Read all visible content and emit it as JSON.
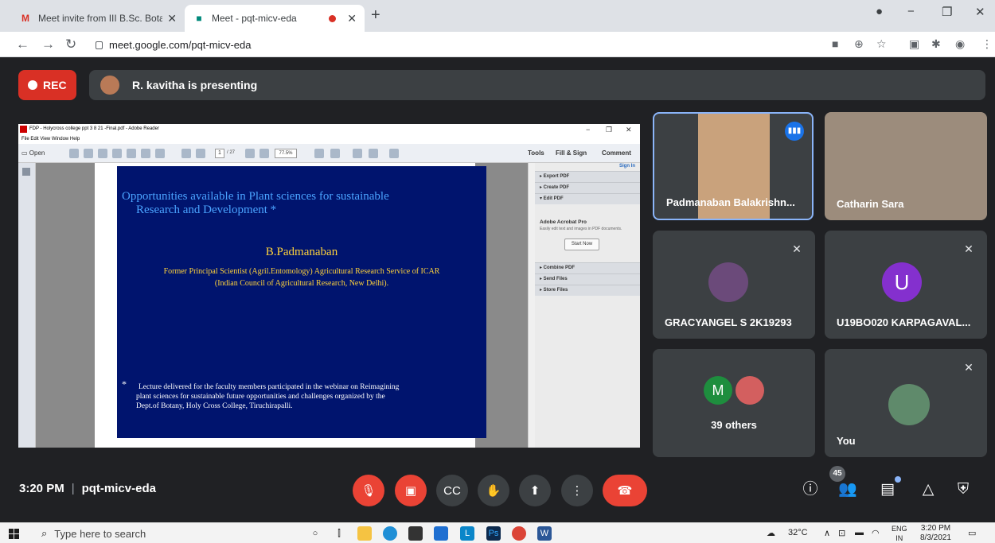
{
  "browser": {
    "tabs": [
      {
        "title": "Meet invite from III B.Sc. Botany"
      },
      {
        "title": "Meet - pqt-micv-eda"
      }
    ],
    "url": "meet.google.com/pqt-micv-eda"
  },
  "meet": {
    "rec_label": "REC",
    "presenting_text": "R. kavitha is presenting",
    "meeting_time": "3:20 PM",
    "meeting_code": "pqt-micv-eda",
    "people_count": "45"
  },
  "reader": {
    "window_title": "FDP - Holycross college ppt 3 8 21 -Final.pdf - Adobe Reader",
    "menu": "File   Edit   View   Window   Help",
    "open_label": "Open",
    "page_current": "1",
    "page_total": "/ 27",
    "zoom": "77.5%",
    "tools_label": "Tools",
    "fill_sign_label": "Fill & Sign",
    "comment_label": "Comment",
    "sign_in": "Sign In",
    "pane": {
      "export_pdf": "▸ Export PDF",
      "create_pdf": "▸ Create PDF",
      "edit_pdf": "▾ Edit PDF",
      "acrobat_pro": "Adobe Acrobat Pro",
      "acrobat_desc": "Easily edit text and images in PDF documents.",
      "start_now": "Start Now",
      "combine_pdf": "▸ Combine PDF",
      "send_files": "▸ Send Files",
      "store_files": "▸ Store Files"
    }
  },
  "slide": {
    "title_line1": "Opportunities available in Plant sciences for sustainable",
    "title_line2": "Research and Development *",
    "presenter": "B.Padmanaban",
    "affiliation_line1": "Former Principal Scientist (Agril.Entomology) Agricultural Research Service of ICAR",
    "affiliation_line2": "(Indian Council of Agricultural Research, New Delhi).",
    "note_star": "*",
    "note_line1": "Lecture delivered for the faculty members participated in the webinar on Reimagining",
    "note_line2": "plant sciences for sustainable future opportunities and challenges organized by the",
    "note_line3": "Dept.of Botany, Holy Cross College, Tiruchirapalli."
  },
  "participants": [
    {
      "name": "Padmanaban Balakrishn...",
      "speaking": true
    },
    {
      "name": "Catharin Sara",
      "muted": false
    },
    {
      "name": "GRACYANGEL S 2K19293",
      "muted": true
    },
    {
      "name": "U19BO020 KARPAGAVAL...",
      "muted": true,
      "initial": "U"
    },
    {
      "label": "39 others",
      "initial": "M"
    },
    {
      "name": "You",
      "muted": true
    }
  ],
  "taskbar": {
    "search_placeholder": "Type here to search",
    "temperature": "32°C",
    "lang_top": "ENG",
    "lang_bottom": "IN",
    "time": "3:20 PM",
    "date": "8/3/2021"
  },
  "colors": {
    "meet_bg": "#202124",
    "tile_bg": "#3c4043",
    "rec_red": "#d93025",
    "hangup_red": "#ea4335",
    "active_border": "#8ab4f8",
    "slide_bg": "#00146e",
    "slide_title": "#4aa3ff",
    "slide_gold": "#ffd33b"
  }
}
